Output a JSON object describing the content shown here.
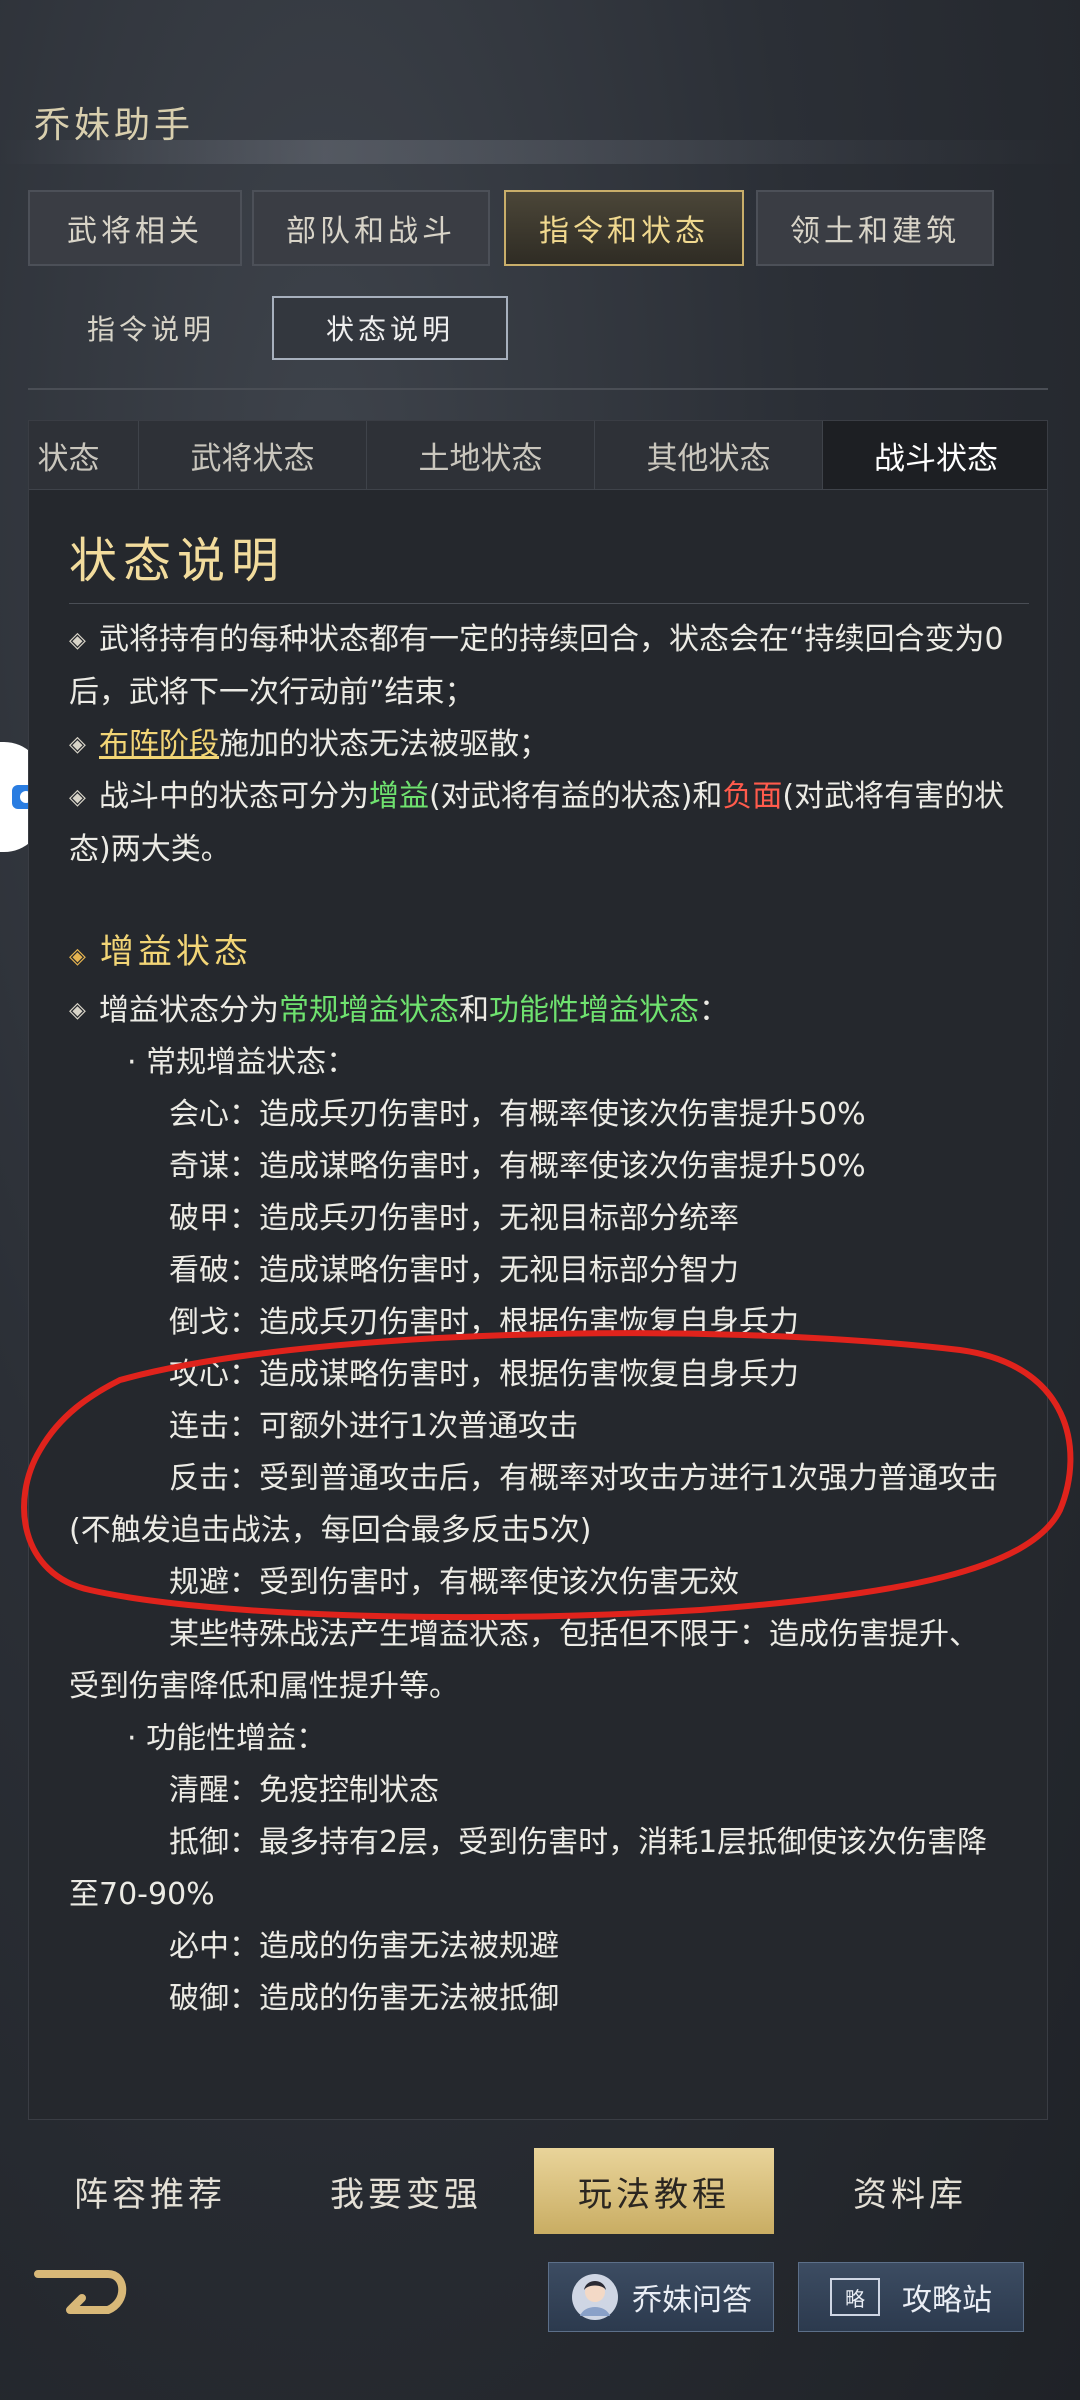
{
  "app": {
    "title": "乔妹助手"
  },
  "category_tabs": [
    {
      "label": "武将相关"
    },
    {
      "label": "部队和战斗"
    },
    {
      "label": "指令和状态",
      "active": true
    },
    {
      "label": "领土和建筑"
    }
  ],
  "sub_tabs": [
    {
      "label": "指令说明"
    },
    {
      "label": "状态说明",
      "active": true
    }
  ],
  "state_tabs": [
    {
      "label": "状态"
    },
    {
      "label": "武将状态"
    },
    {
      "label": "土地状态"
    },
    {
      "label": "其他状态"
    },
    {
      "label": "战斗状态",
      "active": true
    }
  ],
  "content": {
    "heading": "状态说明",
    "intro": {
      "p1": "武将持有的每种状态都有一定的持续回合，状态会在“持续回合变为0后，武将下一次行动前”结束；",
      "p2_link": "布阵阶段",
      "p2_rest": "施加的状态无法被驱散；",
      "p3_a": "战斗中的状态可分为",
      "p3_green": "增益",
      "p3_b": "(对武将有益的状态)和",
      "p3_red": "负面",
      "p3_c": "(对武将有害的状态)两大类。"
    },
    "buff_section": {
      "title": "增益状态",
      "lead_a": "增益状态分为",
      "lead_green1": "常规增益状态",
      "lead_b": "和",
      "lead_green2": "功能性增益状态",
      "lead_c": "：",
      "regular_title": "· 常规增益状态：",
      "regular_items": [
        "会心：造成兵刃伤害时，有概率使该次伤害提升50%",
        "奇谋：造成谋略伤害时，有概率使该次伤害提升50%",
        "破甲：造成兵刃伤害时，无视目标部分统率",
        "看破：造成谋略伤害时，无视目标部分智力",
        "倒戈：造成兵刃伤害时，根据伤害恢复自身兵力",
        "攻心：造成谋略伤害时，根据伤害恢复自身兵力",
        "连击：可额外进行1次普通攻击"
      ],
      "counter_a": "反击：受到普通攻击后，有概率对攻击方进行1次强力普通攻击",
      "counter_b": "(不触发追击战法，每回合最多反击5次)",
      "dodge": "规避：受到伤害时，有概率使该次伤害无效",
      "special_a": "某些特殊战法产生增益状态，包括但不限于：造成伤害提升、",
      "special_b": "受到伤害降低和属性提升等。",
      "functional_title": "· 功能性增益：",
      "functional_items": [
        "清醒：免疫控制状态"
      ],
      "resist_a": "抵御：最多持有2层，受到伤害时，消耗1层抵御使该次伤害降",
      "resist_b": "至70-90%",
      "functional_items2": [
        "必中：造成的伤害无法被规避",
        "破御：造成的伤害无法被抵御"
      ]
    }
  },
  "bottom_nav": [
    {
      "label": "阵容推荐"
    },
    {
      "label": "我要变强"
    },
    {
      "label": "玩法教程",
      "active": true
    },
    {
      "label": "资料库"
    }
  ],
  "footer": {
    "qa_label": "乔妹问答",
    "guide_label": "攻略站",
    "guide_badge": "略"
  },
  "colors": {
    "accent_gold": "#c9ae6a",
    "highlight_green": "#6fe26f",
    "highlight_red": "#ff5b4c",
    "annotation_red": "#e0231c"
  }
}
